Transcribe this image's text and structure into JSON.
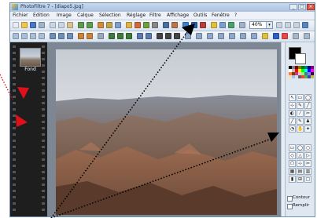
{
  "window": {
    "title": "PhotoFiltre 7 - [diapo5.jpg]"
  },
  "window_controls": {
    "minimize": "_",
    "maximize": "□",
    "close": "×"
  },
  "menu": [
    "Fichier",
    "Edition",
    "Image",
    "Calque",
    "Sélection",
    "Réglage",
    "Filtre",
    "Affichage",
    "Outils",
    "Fenêtre",
    "?"
  ],
  "toolbar": {
    "zoom_value": "40%",
    "zoom_arrow": "▾"
  },
  "filmstrip": {
    "layer_label": "Fond"
  },
  "tools": [
    "↖",
    "▭",
    "◯",
    "⊹",
    "✎",
    "╱",
    "◐",
    "⁄",
    "✂",
    "╱",
    "✎",
    "♟",
    "◔",
    "✋",
    "✦"
  ],
  "shapes": [
    "▭",
    "◯",
    "○",
    "◇",
    "△",
    "▷",
    "⬠",
    "⊹",
    "✂",
    "▦",
    "▤",
    "▥",
    "▮",
    "⊞",
    "▢"
  ],
  "options": {
    "contour_label": "Contour",
    "remplir_label": "Remplir"
  },
  "colors": {
    "accent": "#c63c8a",
    "annotation": "#e0101a",
    "frame": "#d8e4f0"
  }
}
